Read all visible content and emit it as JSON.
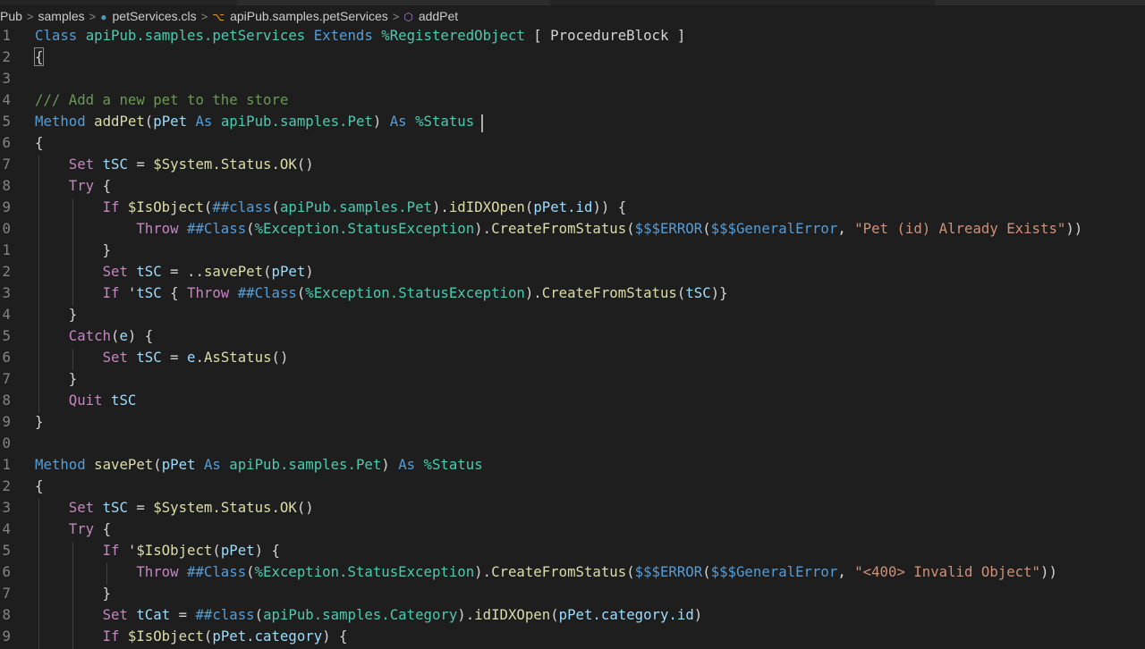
{
  "breadcrumb": {
    "items": [
      {
        "label": "Pub",
        "icon": ""
      },
      {
        "label": "samples",
        "icon": ""
      },
      {
        "label": "petServices.cls",
        "icon": "file-dot-icon"
      },
      {
        "label": "apiPub.samples.petServices",
        "icon": "class-icon"
      },
      {
        "label": "addPet",
        "icon": "method-cube-icon"
      }
    ],
    "separator": ">"
  },
  "colors": {
    "background": "#1e1e1e",
    "keyword": "#c586c0",
    "declaration": "#569cd6",
    "class": "#4ec9b0",
    "function": "#dcdcaa",
    "variable": "#9cdcfe",
    "string": "#ce9178",
    "comment": "#6a9955"
  },
  "code": {
    "lines": [
      {
        "n": "1",
        "t": [
          [
            "d",
            "Class"
          ],
          [
            "p",
            " "
          ],
          [
            "c",
            "apiPub.samples.petServices"
          ],
          [
            "p",
            " "
          ],
          [
            "d",
            "Extends"
          ],
          [
            "p",
            " "
          ],
          [
            "c",
            "%RegisteredObject"
          ],
          [
            "p",
            " [ ProcedureBlock ]"
          ]
        ]
      },
      {
        "n": "2",
        "t": [
          [
            "p",
            "{"
          ]
        ]
      },
      {
        "n": "3",
        "t": []
      },
      {
        "n": "4",
        "t": [
          [
            "m",
            "/// Add a new pet to the store"
          ]
        ]
      },
      {
        "n": "5",
        "t": [
          [
            "d",
            "Method"
          ],
          [
            "p",
            " "
          ],
          [
            "f",
            "addPet"
          ],
          [
            "p",
            "("
          ],
          [
            "v",
            "pPet"
          ],
          [
            "p",
            " "
          ],
          [
            "d",
            "As"
          ],
          [
            "p",
            " "
          ],
          [
            "c",
            "apiPub.samples.Pet"
          ],
          [
            "p",
            ") "
          ],
          [
            "d",
            "As"
          ],
          [
            "p",
            " "
          ],
          [
            "c",
            "%Status"
          ]
        ]
      },
      {
        "n": "6",
        "t": [
          [
            "p",
            "{"
          ]
        ]
      },
      {
        "n": "7",
        "t": [
          [
            "p",
            "    "
          ],
          [
            "k",
            "Set"
          ],
          [
            "p",
            " "
          ],
          [
            "v",
            "tSC"
          ],
          [
            "p",
            " = "
          ],
          [
            "y",
            "$System.Status.OK"
          ],
          [
            "p",
            "()"
          ]
        ]
      },
      {
        "n": "8",
        "t": [
          [
            "p",
            "    "
          ],
          [
            "k",
            "Try"
          ],
          [
            "p",
            " {"
          ]
        ]
      },
      {
        "n": "9",
        "t": [
          [
            "p",
            "        "
          ],
          [
            "k",
            "If"
          ],
          [
            "p",
            " "
          ],
          [
            "y",
            "$IsObject"
          ],
          [
            "p",
            "("
          ],
          [
            "d",
            "##class"
          ],
          [
            "p",
            "("
          ],
          [
            "c",
            "apiPub.samples.Pet"
          ],
          [
            "p",
            ")."
          ],
          [
            "f",
            "idIDXOpen"
          ],
          [
            "p",
            "("
          ],
          [
            "v",
            "pPet.id"
          ],
          [
            "p",
            ")) {"
          ]
        ]
      },
      {
        "n": "0",
        "t": [
          [
            "p",
            "            "
          ],
          [
            "k",
            "Throw"
          ],
          [
            "p",
            " "
          ],
          [
            "d",
            "##Class"
          ],
          [
            "p",
            "("
          ],
          [
            "c",
            "%Exception.StatusException"
          ],
          [
            "p",
            ")."
          ],
          [
            "f",
            "CreateFromStatus"
          ],
          [
            "p",
            "("
          ],
          [
            "b",
            "$$$ERROR"
          ],
          [
            "p",
            "("
          ],
          [
            "b",
            "$$$GeneralError"
          ],
          [
            "p",
            ", "
          ],
          [
            "s",
            "\"Pet (id) Already Exists\""
          ],
          [
            "p",
            "))"
          ]
        ]
      },
      {
        "n": "1",
        "t": [
          [
            "p",
            "        }"
          ]
        ]
      },
      {
        "n": "2",
        "t": [
          [
            "p",
            "        "
          ],
          [
            "k",
            "Set"
          ],
          [
            "p",
            " "
          ],
          [
            "v",
            "tSC"
          ],
          [
            "p",
            " = .."
          ],
          [
            "f",
            "savePet"
          ],
          [
            "p",
            "("
          ],
          [
            "v",
            "pPet"
          ],
          [
            "p",
            ")"
          ]
        ]
      },
      {
        "n": "3",
        "t": [
          [
            "p",
            "        "
          ],
          [
            "k",
            "If"
          ],
          [
            "p",
            " '"
          ],
          [
            "v",
            "tSC"
          ],
          [
            "p",
            " { "
          ],
          [
            "k",
            "Throw"
          ],
          [
            "p",
            " "
          ],
          [
            "d",
            "##Class"
          ],
          [
            "p",
            "("
          ],
          [
            "c",
            "%Exception.StatusException"
          ],
          [
            "p",
            ")."
          ],
          [
            "f",
            "CreateFromStatus"
          ],
          [
            "p",
            "("
          ],
          [
            "v",
            "tSC"
          ],
          [
            "p",
            ")}"
          ]
        ]
      },
      {
        "n": "4",
        "t": [
          [
            "p",
            "    }"
          ]
        ]
      },
      {
        "n": "5",
        "t": [
          [
            "p",
            "    "
          ],
          [
            "k",
            "Catch"
          ],
          [
            "p",
            "("
          ],
          [
            "v",
            "e"
          ],
          [
            "p",
            ") {"
          ]
        ]
      },
      {
        "n": "6",
        "t": [
          [
            "p",
            "        "
          ],
          [
            "k",
            "Set"
          ],
          [
            "p",
            " "
          ],
          [
            "v",
            "tSC"
          ],
          [
            "p",
            " = "
          ],
          [
            "v",
            "e"
          ],
          [
            "p",
            "."
          ],
          [
            "f",
            "AsStatus"
          ],
          [
            "p",
            "()"
          ]
        ]
      },
      {
        "n": "7",
        "t": [
          [
            "p",
            "    }"
          ]
        ]
      },
      {
        "n": "8",
        "t": [
          [
            "p",
            "    "
          ],
          [
            "k",
            "Quit"
          ],
          [
            "p",
            " "
          ],
          [
            "v",
            "tSC"
          ]
        ]
      },
      {
        "n": "9",
        "t": [
          [
            "p",
            "}"
          ]
        ]
      },
      {
        "n": "0",
        "t": []
      },
      {
        "n": "1",
        "t": [
          [
            "d",
            "Method"
          ],
          [
            "p",
            " "
          ],
          [
            "f",
            "savePet"
          ],
          [
            "p",
            "("
          ],
          [
            "v",
            "pPet"
          ],
          [
            "p",
            " "
          ],
          [
            "d",
            "As"
          ],
          [
            "p",
            " "
          ],
          [
            "c",
            "apiPub.samples.Pet"
          ],
          [
            "p",
            ") "
          ],
          [
            "d",
            "As"
          ],
          [
            "p",
            " "
          ],
          [
            "c",
            "%Status"
          ]
        ]
      },
      {
        "n": "2",
        "t": [
          [
            "p",
            "{"
          ]
        ]
      },
      {
        "n": "3",
        "t": [
          [
            "p",
            "    "
          ],
          [
            "k",
            "Set"
          ],
          [
            "p",
            " "
          ],
          [
            "v",
            "tSC"
          ],
          [
            "p",
            " = "
          ],
          [
            "y",
            "$System.Status.OK"
          ],
          [
            "p",
            "()"
          ]
        ]
      },
      {
        "n": "4",
        "t": [
          [
            "p",
            "    "
          ],
          [
            "k",
            "Try"
          ],
          [
            "p",
            " {"
          ]
        ]
      },
      {
        "n": "5",
        "t": [
          [
            "p",
            "        "
          ],
          [
            "k",
            "If"
          ],
          [
            "p",
            " '"
          ],
          [
            "y",
            "$IsObject"
          ],
          [
            "p",
            "("
          ],
          [
            "v",
            "pPet"
          ],
          [
            "p",
            ") {"
          ]
        ]
      },
      {
        "n": "6",
        "t": [
          [
            "p",
            "            "
          ],
          [
            "k",
            "Throw"
          ],
          [
            "p",
            " "
          ],
          [
            "d",
            "##Class"
          ],
          [
            "p",
            "("
          ],
          [
            "c",
            "%Exception.StatusException"
          ],
          [
            "p",
            ")."
          ],
          [
            "f",
            "CreateFromStatus"
          ],
          [
            "p",
            "("
          ],
          [
            "b",
            "$$$ERROR"
          ],
          [
            "p",
            "("
          ],
          [
            "b",
            "$$$GeneralError"
          ],
          [
            "p",
            ", "
          ],
          [
            "s",
            "\"<400> Invalid Object\""
          ],
          [
            "p",
            "))"
          ]
        ]
      },
      {
        "n": "7",
        "t": [
          [
            "p",
            "        }"
          ]
        ]
      },
      {
        "n": "8",
        "t": [
          [
            "p",
            "        "
          ],
          [
            "k",
            "Set"
          ],
          [
            "p",
            " "
          ],
          [
            "v",
            "tCat"
          ],
          [
            "p",
            " = "
          ],
          [
            "d",
            "##class"
          ],
          [
            "p",
            "("
          ],
          [
            "c",
            "apiPub.samples.Category"
          ],
          [
            "p",
            ")."
          ],
          [
            "f",
            "idIDXOpen"
          ],
          [
            "p",
            "("
          ],
          [
            "v",
            "pPet.category.id"
          ],
          [
            "p",
            ")"
          ]
        ]
      },
      {
        "n": "9",
        "t": [
          [
            "p",
            "        "
          ],
          [
            "k",
            "If"
          ],
          [
            "p",
            " "
          ],
          [
            "y",
            "$IsObject"
          ],
          [
            "p",
            "("
          ],
          [
            "v",
            "pPet.category"
          ],
          [
            "p",
            ") {"
          ]
        ]
      }
    ]
  }
}
